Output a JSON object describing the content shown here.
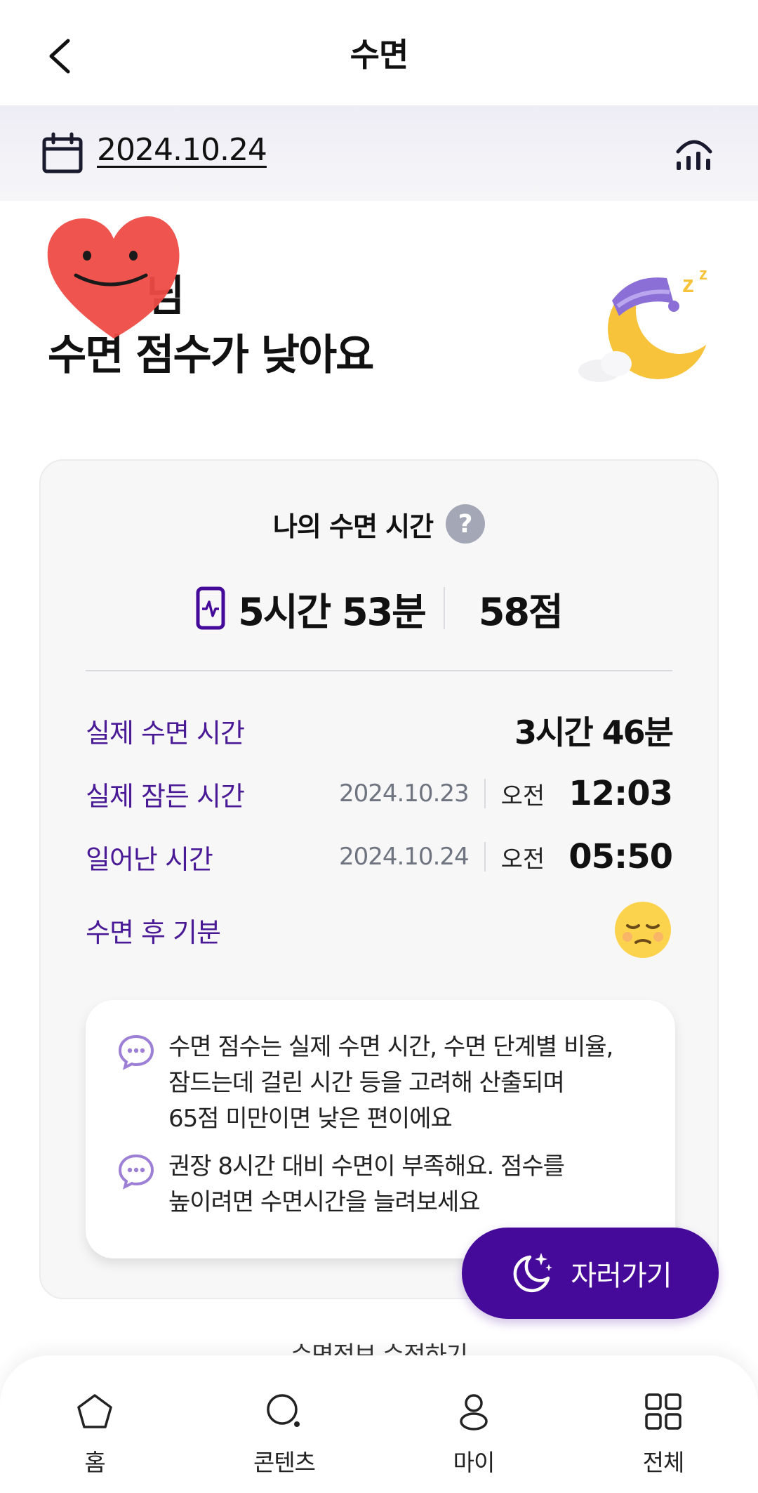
{
  "header": {
    "title": "수면"
  },
  "date_bar": {
    "date": "2024.10.24"
  },
  "greeting": {
    "name_line": "님",
    "message": "수면 점수가 낮아요"
  },
  "card": {
    "title": "나의 수면 시간",
    "help_icon_glyph": "?",
    "duration": "5시간 53분",
    "score": "58점",
    "rows": [
      {
        "label": "실제 수면 시간",
        "value": "3시간 46분"
      },
      {
        "label": "실제 잠든 시간",
        "date": "2024.10.23",
        "ampm": "오전",
        "time": "12:03"
      },
      {
        "label": "일어난 시간",
        "date": "2024.10.24",
        "ampm": "오전",
        "time": "05:50"
      },
      {
        "label": "수면 후 기분",
        "mood_icon": "sleepy-face-emoji"
      }
    ],
    "notes": [
      {
        "text_lines": [
          "수면 점수는 실제 수면 시간, 수면 단계별 비율,",
          "잠드는데 걸린 시간 등을 고려해 산출되며",
          "65점 미만이면 낮은 편이에요"
        ]
      },
      {
        "text_lines": [
          "권장 8시간 대비 수면이 부족해요. 점수를",
          "높이려면 수면시간을 늘려보세요"
        ]
      }
    ]
  },
  "fab": {
    "label": "자러가기",
    "icon": "moon-stars-icon"
  },
  "edit_link": {
    "label": "수면정보 수정하기"
  },
  "bottom_nav": {
    "items": [
      {
        "label": "홈",
        "icon": "home-icon"
      },
      {
        "label": "콘텐츠",
        "icon": "search-icon"
      },
      {
        "label": "마이",
        "icon": "person-icon"
      },
      {
        "label": "전체",
        "icon": "grid-icon"
      }
    ]
  },
  "colors": {
    "accent": "#460a9a",
    "label_purple": "#4a1a96",
    "date_bar_bg": "#f3f3f7",
    "card_bg": "#f7f7f8"
  }
}
